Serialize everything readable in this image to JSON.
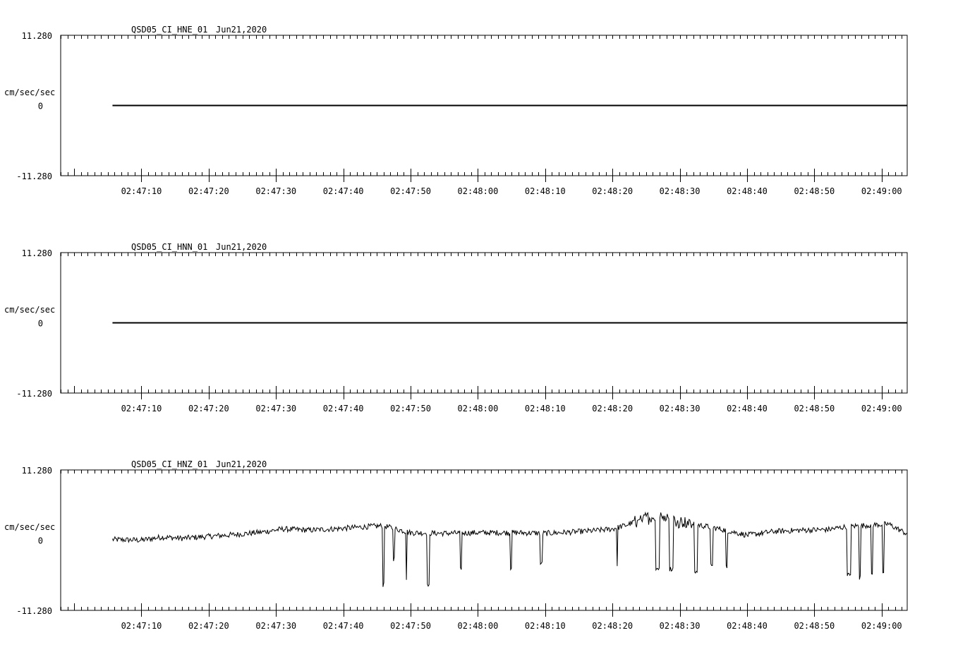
{
  "colors": {
    "background": "#ffffff",
    "ink": "#000000"
  },
  "chart_data": [
    {
      "type": "line",
      "station": "QSD05_CI_HNE_01",
      "date": "Jun21,2020",
      "ylabel": "cm/sec/sec",
      "ylim": [
        -11.28,
        11.28
      ],
      "ytick_labels": {
        "top": "11.280",
        "zero": "0",
        "bottom": "-11.280"
      },
      "xlim_seconds_of_day": [
        10018.0,
        10143.8
      ],
      "xtick_labels": [
        "02:47:10",
        "02:47:20",
        "02:47:30",
        "02:47:40",
        "02:47:50",
        "02:48:00",
        "02:48:10",
        "02:48:20",
        "02:48:30",
        "02:48:40",
        "02:48:50",
        "02:49:00"
      ],
      "trace_start": "02:47:05.7",
      "trace_end": "02:49:03.8",
      "trace_level": 0.0,
      "trace": "flat"
    },
    {
      "type": "line",
      "station": "QSD05_CI_HNN_01",
      "date": "Jun21,2020",
      "ylabel": "cm/sec/sec",
      "ylim": [
        -11.28,
        11.28
      ],
      "ytick_labels": {
        "top": "11.280",
        "zero": "0",
        "bottom": "-11.280"
      },
      "xlim_seconds_of_day": [
        10018.0,
        10143.8
      ],
      "xtick_labels": [
        "02:47:10",
        "02:47:20",
        "02:47:30",
        "02:47:40",
        "02:47:50",
        "02:48:00",
        "02:48:10",
        "02:48:20",
        "02:48:30",
        "02:48:40",
        "02:48:50",
        "02:49:00"
      ],
      "trace_start": "02:47:05.7",
      "trace_end": "02:49:03.8",
      "trace_level": 0.0,
      "trace": "flat"
    },
    {
      "type": "line",
      "station": "QSD05_CI_HNZ_01",
      "date": "Jun21,2020",
      "ylabel": "cm/sec/sec",
      "ylim": [
        -11.28,
        11.28
      ],
      "ytick_labels": {
        "top": "11.280",
        "zero": "0",
        "bottom": "-11.280"
      },
      "xlim_seconds_of_day": [
        10018.0,
        10143.8
      ],
      "xtick_labels": [
        "02:47:10",
        "02:47:20",
        "02:47:30",
        "02:47:40",
        "02:47:50",
        "02:48:00",
        "02:48:10",
        "02:48:20",
        "02:48:30",
        "02:48:40",
        "02:48:50",
        "02:49:00"
      ],
      "trace_start": "02:47:05.7",
      "trace_end": "02:49:03.8",
      "trace": "noisy",
      "trace_baseline": [
        [
          10025.7,
          0.1
        ],
        [
          10030.0,
          0.0
        ],
        [
          10033.0,
          0.5
        ],
        [
          10036.0,
          0.3
        ],
        [
          10040.0,
          0.6
        ],
        [
          10044.0,
          0.9
        ],
        [
          10048.0,
          1.3
        ],
        [
          10051.0,
          1.8
        ],
        [
          10055.0,
          1.6
        ],
        [
          10060.0,
          1.9
        ],
        [
          10064.0,
          2.2
        ],
        [
          10066.0,
          2.3
        ],
        [
          10070.0,
          1.2
        ],
        [
          10075.0,
          1.1
        ],
        [
          10080.0,
          1.2
        ],
        [
          10086.0,
          1.2
        ],
        [
          10090.0,
          1.1
        ],
        [
          10094.0,
          1.3
        ],
        [
          10097.0,
          1.5
        ],
        [
          10100.0,
          1.8
        ],
        [
          10102.0,
          2.4
        ],
        [
          10105.0,
          3.6
        ],
        [
          10108.0,
          3.8
        ],
        [
          10110.0,
          3.0
        ],
        [
          10113.0,
          2.4
        ],
        [
          10116.0,
          1.8
        ],
        [
          10120.0,
          0.8
        ],
        [
          10124.0,
          1.4
        ],
        [
          10128.0,
          1.6
        ],
        [
          10132.0,
          1.7
        ],
        [
          10135.0,
          2.2
        ],
        [
          10138.0,
          2.4
        ],
        [
          10141.0,
          2.6
        ],
        [
          10143.8,
          1.0
        ]
      ],
      "dropouts": [
        {
          "start": 10065.8,
          "end": 10066.1,
          "value": -7.2
        },
        {
          "start": 10067.4,
          "end": 10067.7,
          "value": -3.0
        },
        {
          "start": 10069.3,
          "end": 10069.5,
          "value": -6.2
        },
        {
          "start": 10072.4,
          "end": 10072.8,
          "value": -7.4
        },
        {
          "start": 10077.4,
          "end": 10077.6,
          "value": -4.8
        },
        {
          "start": 10084.8,
          "end": 10085.0,
          "value": -4.4
        },
        {
          "start": 10089.2,
          "end": 10089.6,
          "value": -3.8
        },
        {
          "start": 10100.6,
          "end": 10100.8,
          "value": -4.2
        },
        {
          "start": 10106.4,
          "end": 10107.0,
          "value": -4.6
        },
        {
          "start": 10108.4,
          "end": 10109.0,
          "value": -4.6
        },
        {
          "start": 10112.2,
          "end": 10112.6,
          "value": -5.2
        },
        {
          "start": 10114.6,
          "end": 10114.9,
          "value": -4.2
        },
        {
          "start": 10116.8,
          "end": 10117.1,
          "value": -4.4
        },
        {
          "start": 10134.8,
          "end": 10135.4,
          "value": -5.6
        },
        {
          "start": 10136.6,
          "end": 10136.9,
          "value": -6.0
        },
        {
          "start": 10138.4,
          "end": 10138.7,
          "value": -5.6
        },
        {
          "start": 10140.1,
          "end": 10140.4,
          "value": -5.6
        }
      ]
    }
  ]
}
